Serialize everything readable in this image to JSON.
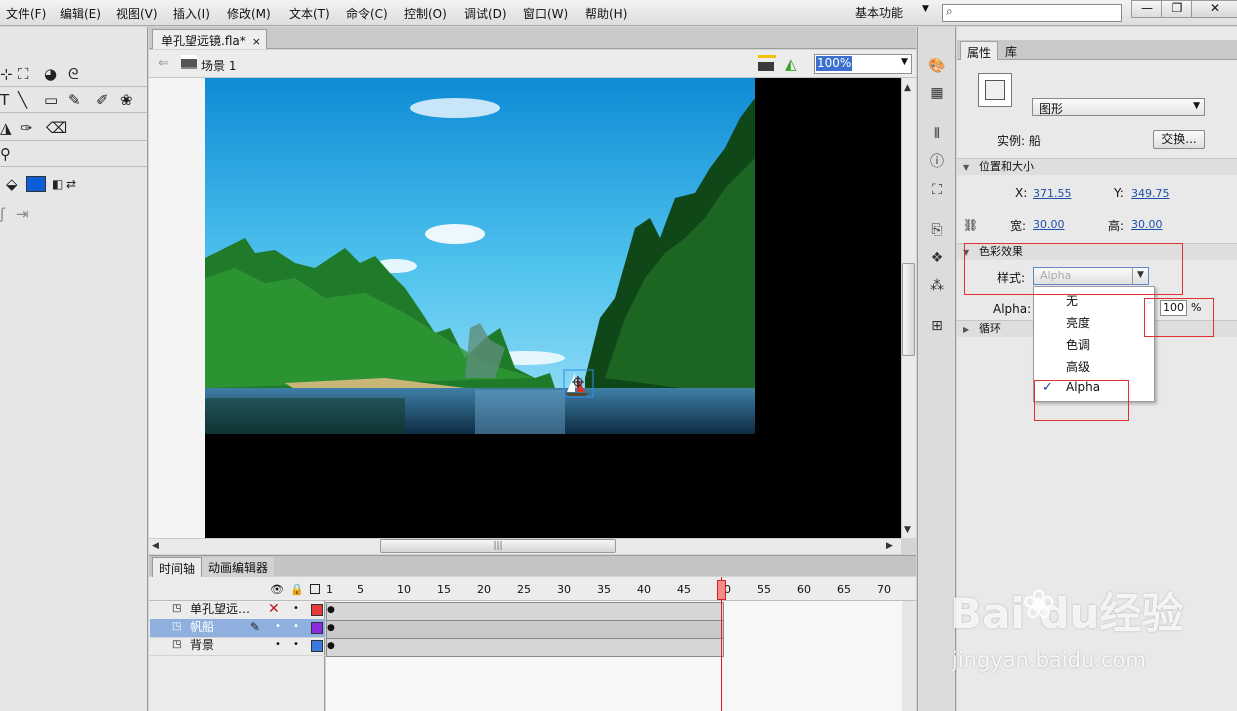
{
  "menu": [
    "文件(F)",
    "编辑(E)",
    "视图(V)",
    "插入(I)",
    "修改(M)",
    "文本(T)",
    "命令(C)",
    "控制(O)",
    "调试(D)",
    "窗口(W)",
    "帮助(H)"
  ],
  "workspace": "基本功能",
  "window_controls": {
    "minimize": "—",
    "restore": "❐",
    "close": "✕"
  },
  "doc_tab": {
    "title": "单孔望远镜.fla*",
    "close": "×"
  },
  "scene": {
    "label": "场景 1",
    "zoom": "100%"
  },
  "timeline": {
    "tabs": [
      "时间轴",
      "动画编辑器"
    ],
    "frame_numbers": [
      "1",
      "5",
      "10",
      "15",
      "20",
      "25",
      "30",
      "35",
      "40",
      "45",
      "50",
      "55",
      "60",
      "65",
      "70"
    ],
    "current_frame": "50",
    "layers": [
      {
        "name": "单孔望远…",
        "color": "#e53a3a",
        "selected": false,
        "hidden_mark": "✕"
      },
      {
        "name": "帆船",
        "color": "#8a2be2",
        "selected": true
      },
      {
        "name": "背景",
        "color": "#3b7be0",
        "selected": false
      }
    ]
  },
  "properties": {
    "tabs": [
      "属性",
      "库"
    ],
    "symbol_type": "图形",
    "instance_label": "实例: 船",
    "swap_button": "交换...",
    "section_position": "位置和大小",
    "x_label": "X:",
    "x_value": "371.55",
    "y_label": "Y:",
    "y_value": "349.75",
    "width_label": "宽:",
    "width_value": "30.00",
    "height_label": "高:",
    "height_value": "30.00",
    "section_color": "色彩效果",
    "style_label": "样式:",
    "style_value": "Alpha",
    "alpha_label": "Alpha:",
    "alpha_value": "100",
    "alpha_unit": "%",
    "section_loop": "循环",
    "style_options": [
      "无",
      "亮度",
      "色调",
      "高级",
      "Alpha"
    ],
    "style_selected": "Alpha"
  },
  "watermark": {
    "logo": "Bai  du经验",
    "url": "jingyan.baidu.com"
  },
  "colors": {
    "fill_swatch": "#0b5fd6",
    "accent_red": "#e03030",
    "selection_blue": "#3b6fd0"
  }
}
